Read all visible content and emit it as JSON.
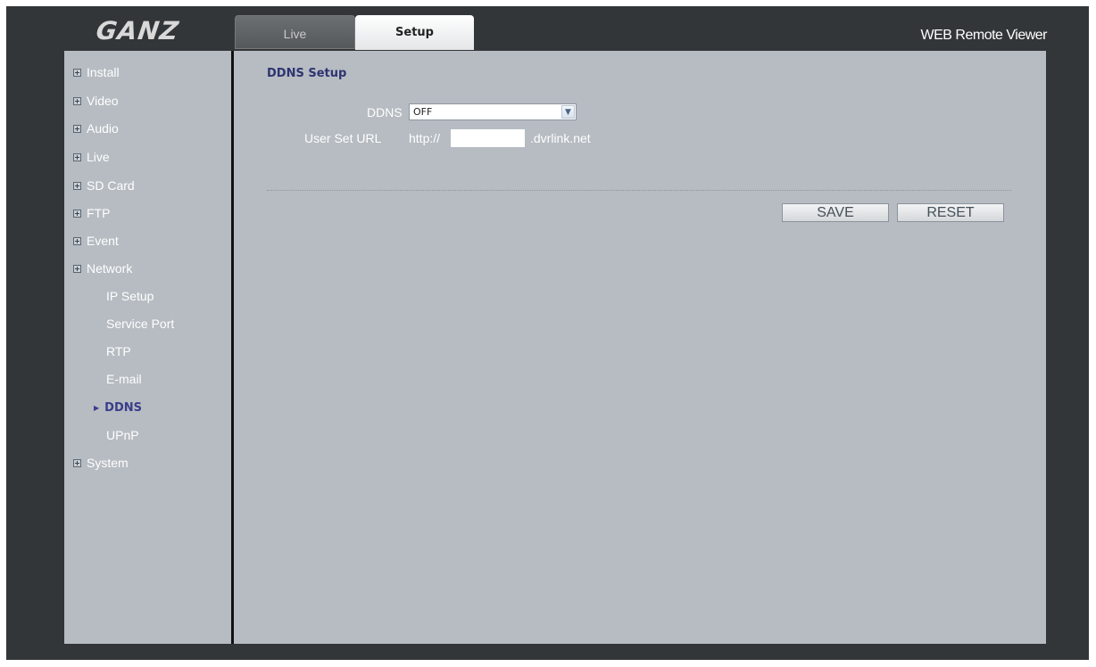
{
  "header": {
    "logo": "GANZ",
    "tabs": [
      {
        "label": "Live",
        "active": false
      },
      {
        "label": "Setup",
        "active": true
      }
    ],
    "viewer_title": "WEB Remote Viewer"
  },
  "sidebar": {
    "items": [
      {
        "label": "Install"
      },
      {
        "label": "Video"
      },
      {
        "label": "Audio"
      },
      {
        "label": "Live"
      },
      {
        "label": "SD Card"
      },
      {
        "label": "FTP"
      },
      {
        "label": "Event"
      },
      {
        "label": "Network"
      }
    ],
    "network_subitems": [
      {
        "label": "IP Setup"
      },
      {
        "label": "Service Port"
      },
      {
        "label": "RTP"
      },
      {
        "label": "E-mail"
      },
      {
        "label": "DDNS",
        "active": true
      },
      {
        "label": "UPnP"
      }
    ],
    "last_item": {
      "label": "System"
    }
  },
  "main": {
    "section_title": "DDNS Setup",
    "ddns_label": "DDNS",
    "ddns_value": "OFF",
    "user_url_label": "User Set URL",
    "url_prefix": "http://",
    "url_value": "",
    "url_suffix": ".dvrlink.net",
    "save_label": "SAVE",
    "reset_label": "RESET"
  },
  "colors": {
    "frame": "#333638",
    "panel": "#b6bcc2",
    "active_nav": "#3a3d8a"
  }
}
